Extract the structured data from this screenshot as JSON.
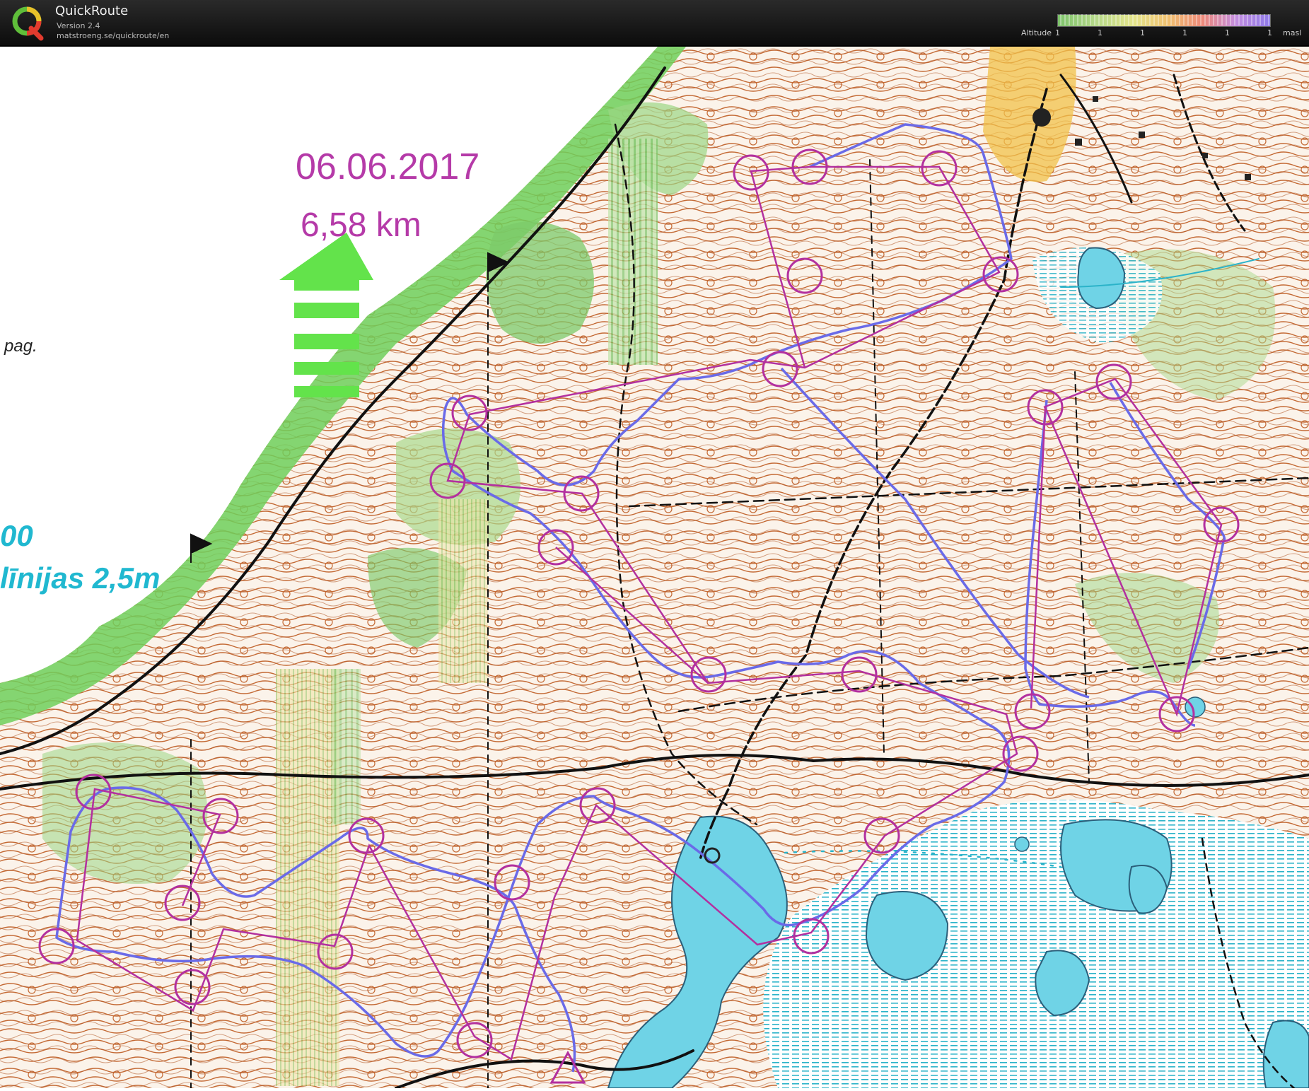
{
  "app": {
    "title": "QuickRoute",
    "version": "Version 2.4",
    "url": "matstroeng.se/quickroute/en"
  },
  "legend": {
    "label": "Altitude",
    "ticks": [
      "1",
      "1",
      "1",
      "1",
      "1",
      "1"
    ],
    "unit": "masl"
  },
  "map": {
    "date": "06.06.2017",
    "distance": "6,58 km",
    "left_edge_text": "pag.",
    "contour_text_a": "00",
    "contour_text_b": "līnijas 2,5m"
  },
  "colors": {
    "course": "#b3309f",
    "route": "#6a6ae8",
    "north_arrow": "#63e34b",
    "water": "#6fd3e6",
    "contour": "#b35a2a"
  }
}
